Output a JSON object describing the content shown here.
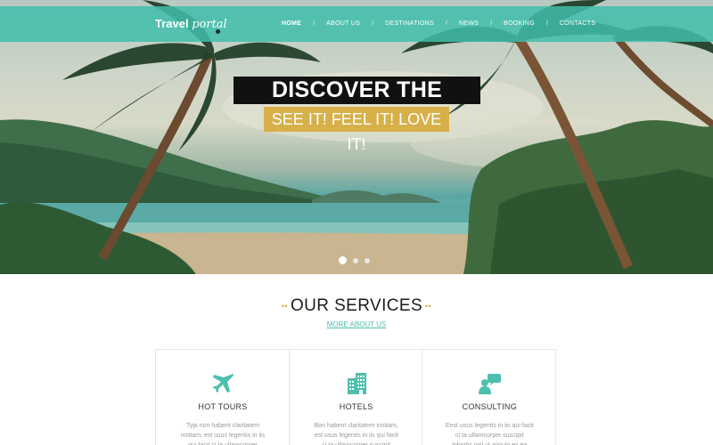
{
  "nav": {
    "logo_bold": "Travel",
    "logo_script": "portal",
    "items": [
      {
        "label": "HOME",
        "active": true
      },
      {
        "label": "ABOUT US",
        "active": false
      },
      {
        "label": "DESTINATIONS",
        "active": false
      },
      {
        "label": "NEWS",
        "active": false
      },
      {
        "label": "BOOKING",
        "active": false
      },
      {
        "label": "CONTACTS",
        "active": false
      }
    ],
    "separator": "/"
  },
  "hero": {
    "headline": "DISCOVER THE PLANET",
    "subheadline": "SEE IT! FEEL IT! LOVE IT!",
    "slides": 3,
    "active_slide": 1
  },
  "services": {
    "ornament": "••",
    "title": "OUR SERVICES",
    "more_link": "MORE ABOUT US",
    "cards": [
      {
        "icon": "airplane-icon",
        "title": "HOT TOURS",
        "text": "Typi non habent claritatem insitam; est usus legentis in iis qui facit ci ta ullamcorper"
      },
      {
        "icon": "hotel-building-icon",
        "title": "HOTELS",
        "text": "Bon habent claritatem insitam, est usus legentis in iis qui facit ci ta ullamcorper suscipit"
      },
      {
        "icon": "consulting-person-icon",
        "title": "CONSULTING",
        "text": "Eest usus legentis in iis qui facit ci ta ullamcorper suscipit lobortis nisl ut aliquip ex ea"
      }
    ]
  },
  "colors": {
    "accent": "#4dbfae",
    "nav_bg": "#40beaa",
    "subhead_bg": "#d7b04a",
    "ornament": "#e1a743"
  }
}
